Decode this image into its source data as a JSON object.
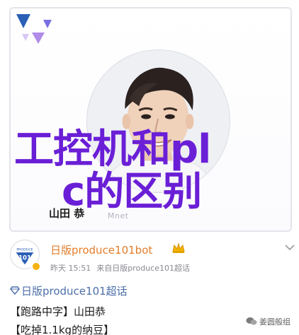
{
  "overlay": {
    "title_line1": "工控机和pl",
    "title_line2": "c的区别"
  },
  "profile_card": {
    "name": "山田 恭",
    "watermark": "Mnet"
  },
  "post": {
    "author": "日版produce101bot",
    "meta_time": "昨天 15:51",
    "meta_source": "来自日版produce101超话",
    "topic": "日版produce101超话",
    "line1": "【跑路中字】山田恭",
    "line2": "【吃掉1.1kg的纳豆】"
  },
  "watermark": {
    "text": "姜圆般组"
  },
  "colors": {
    "overlay_text": "#6a1fd6",
    "author": "#e47d2a",
    "topic_link": "#4b6ea8",
    "brand_blue": "#2a5fb5",
    "logo_purple": "#8c6ee0"
  },
  "icons": [
    "produce101-logo",
    "verify-badge-icon",
    "crown-icon",
    "chevron-down-icon",
    "diamond-icon",
    "wechat-icon"
  ]
}
